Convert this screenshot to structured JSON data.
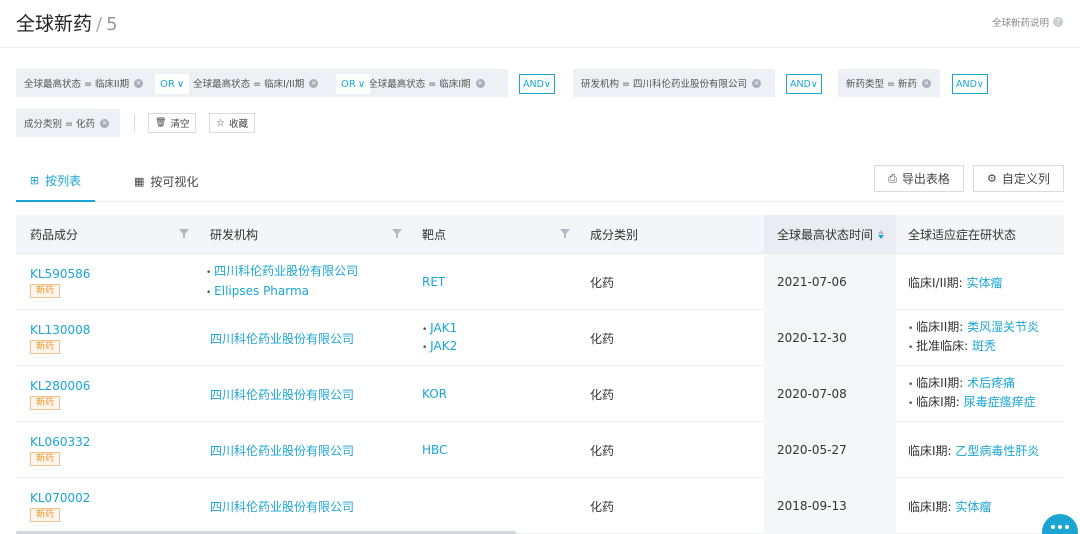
{
  "header": {
    "title": "全球新药",
    "separator": "/",
    "count": "5",
    "help_label": "全球新药说明",
    "help_icon": "?"
  },
  "filters": {
    "chips": [
      {
        "label": "全球最高状态 = 临床II期"
      },
      {
        "label": "全球最高状态 = 临床I/II期"
      },
      {
        "label": "全球最高状态 = 临床I期"
      },
      {
        "label": "研发机构 = 四川科伦药业股份有限公司"
      },
      {
        "label": "新药类型 = 新药"
      },
      {
        "label": "成分类别 = 化药"
      }
    ],
    "or_label": "OR",
    "and_label": "AND",
    "remove_icon": "×",
    "clear_label": "清空",
    "save_label": "收藏"
  },
  "tabs": {
    "list_label": "按列表",
    "visual_label": "按可视化"
  },
  "toolbar": {
    "export_label": "导出表格",
    "custom_label": "自定义列"
  },
  "table": {
    "columns": [
      "药品成分",
      "研发机构",
      "靶点",
      "成分类别",
      "全球最高状态时间",
      "全球适应症在研状态"
    ],
    "new_badge": "新药",
    "rows": [
      {
        "drug": "KL590586",
        "orgs": [
          "四川科伦药业股份有限公司",
          "Ellipses Pharma"
        ],
        "targets": [
          "RET"
        ],
        "category": "化药",
        "date": "2021-07-06",
        "indications": [
          {
            "status": "临床I/II期:",
            "name": "实体瘤"
          }
        ]
      },
      {
        "drug": "KL130008",
        "orgs": [
          "四川科伦药业股份有限公司"
        ],
        "targets": [
          "JAK1",
          "JAK2"
        ],
        "category": "化药",
        "date": "2020-12-30",
        "indications": [
          {
            "status": "临床II期:",
            "name": "类风湿关节炎"
          },
          {
            "status": "批准临床:",
            "name": "斑秃"
          }
        ]
      },
      {
        "drug": "KL280006",
        "orgs": [
          "四川科伦药业股份有限公司"
        ],
        "targets": [
          "KOR"
        ],
        "category": "化药",
        "date": "2020-07-08",
        "indications": [
          {
            "status": "临床II期:",
            "name": "术后疼痛"
          },
          {
            "status": "临床I期:",
            "name": "尿毒症瘙痒症"
          }
        ]
      },
      {
        "drug": "KL060332",
        "orgs": [
          "四川科伦药业股份有限公司"
        ],
        "targets": [
          "HBC"
        ],
        "category": "化药",
        "date": "2020-05-27",
        "indications": [
          {
            "status": "临床I期:",
            "name": "乙型病毒性肝炎"
          }
        ]
      },
      {
        "drug": "KL070002",
        "orgs": [
          "四川科伦药业股份有限公司"
        ],
        "targets": [],
        "category": "化药",
        "date": "2018-09-13",
        "indications": [
          {
            "status": "临床I期:",
            "name": "实体瘤"
          }
        ]
      }
    ]
  }
}
